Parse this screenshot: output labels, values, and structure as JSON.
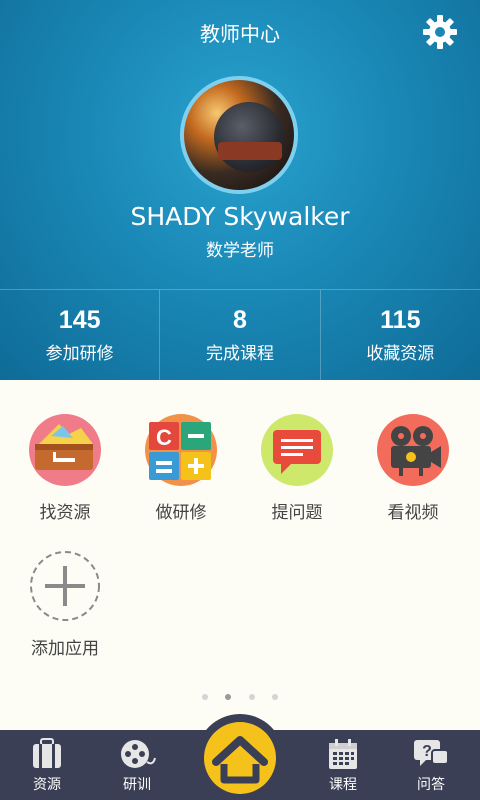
{
  "header": {
    "title": "教师中心",
    "settings_icon": "gear-icon"
  },
  "profile": {
    "name": "SHADY Skywalker",
    "role": "数学老师"
  },
  "stats": [
    {
      "value": "145",
      "label": "参加研修"
    },
    {
      "value": "8",
      "label": "完成课程"
    },
    {
      "value": "115",
      "label": "收藏资源"
    }
  ],
  "apps": [
    {
      "label": "找资源",
      "icon": "folder-icon",
      "color": "#f07c8a"
    },
    {
      "label": "做研修",
      "icon": "calculator-icon",
      "color": "#f2914a"
    },
    {
      "label": "提问题",
      "icon": "chat-bubble-icon",
      "color": "#cde86a"
    },
    {
      "label": "看视频",
      "icon": "film-camera-icon",
      "color": "#f26b5b"
    },
    {
      "label": "添加应用",
      "icon": "add-icon",
      "color": "#8a8a8a"
    }
  ],
  "pager": {
    "pages": 4,
    "current": 2
  },
  "nav": {
    "items": [
      {
        "label": "资源",
        "icon": "briefcase-icon"
      },
      {
        "label": "研训",
        "icon": "film-reel-icon"
      },
      {
        "label": "课程",
        "icon": "calendar-icon"
      },
      {
        "label": "问答",
        "icon": "question-bubble-icon"
      }
    ],
    "home_icon": "home-icon"
  },
  "colors": {
    "header_blue": "#1a88b6",
    "nav_bg": "#3a3f55",
    "home_yellow": "#f5c21b"
  }
}
